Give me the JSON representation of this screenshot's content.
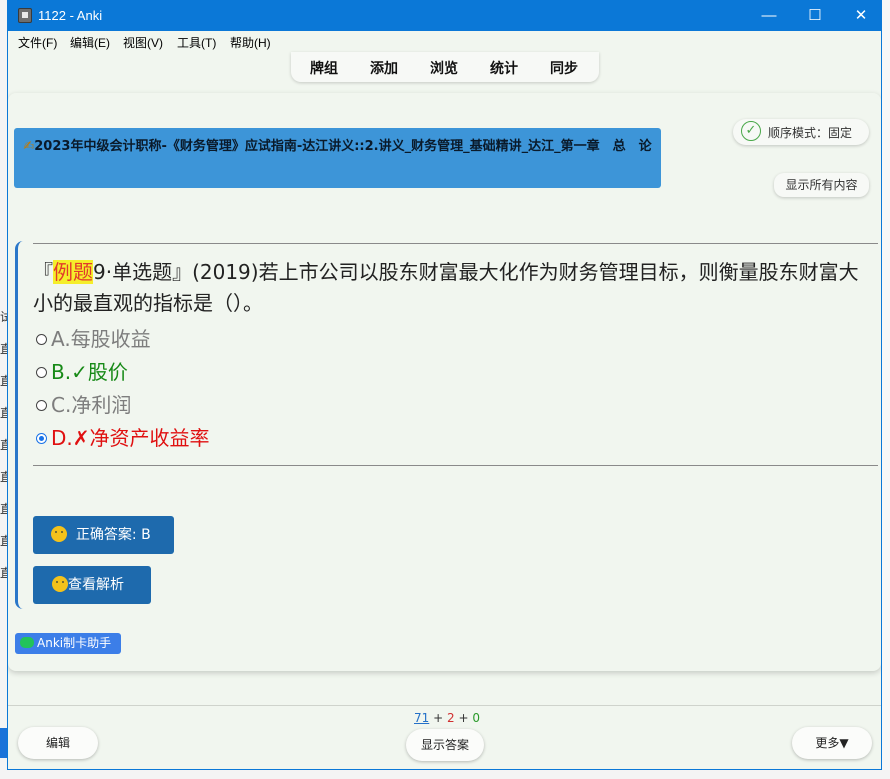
{
  "window": {
    "title": "1122 - Anki",
    "minimize": "—",
    "maximize": "☐",
    "close": "✕"
  },
  "menu": [
    "文件(F)",
    "编辑(E)",
    "视图(V)",
    "工具(T)",
    "帮助(H)"
  ],
  "topnav": [
    "牌组",
    "添加",
    "浏览",
    "统计",
    "同步"
  ],
  "card": {
    "deck_icon": "✍",
    "deck_title": "2023年中级会计职称-《财务管理》应试指南-达江讲义::2.讲义_财务管理_基础精讲_达江_第一章　总　论",
    "order_mode": "顺序模式：固定",
    "show_all": "显示所有内容",
    "question": {
      "open_bracket": "『",
      "tag": "例题",
      "rest": "9·单选题』(2019)若上市公司以股东财富最大化作为财务管理目标，则衡量股东财富大小的最直观的指标是（）。"
    },
    "options": [
      {
        "label": "A.每股收益",
        "state": "unselected"
      },
      {
        "label": "B.✓股价",
        "state": "correct"
      },
      {
        "label": "C.净利润",
        "state": "unselected"
      },
      {
        "label": "D.✗净资产收益率",
        "state": "wrong-selected"
      }
    ],
    "answer_button": "正确答案: B",
    "analysis_button": "查看解析",
    "helper_badge": "Anki制卡助手"
  },
  "footer": {
    "count_new": "71",
    "count_learn": "2",
    "count_review": "0",
    "plus": "+",
    "edit": "编辑",
    "show_answer": "显示答案",
    "more": "更多▼"
  },
  "background": {
    "side_glyph": "直",
    "side_glyph2": "试"
  },
  "colors": {
    "titlebar": "#0b78d7",
    "deck_banner": "#3d95d8",
    "correct": "#178a17",
    "wrong": "#e01010",
    "button": "#1e6aad"
  },
  "icons": [
    "app-icon",
    "pencil-icon",
    "check-circle-icon",
    "smile-emoji-icon",
    "thinking-emoji-icon",
    "wechat-icon"
  ]
}
